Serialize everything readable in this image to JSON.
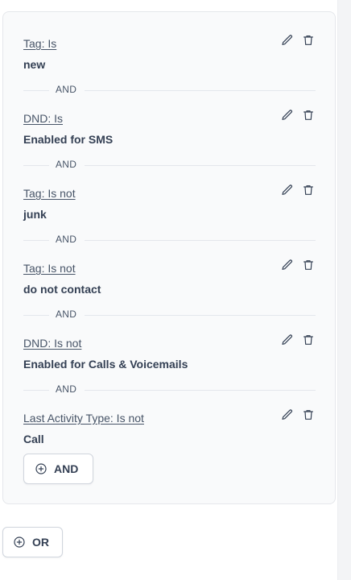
{
  "conditions": [
    {
      "label": "Tag:  Is",
      "value": "new"
    },
    {
      "label": "DND:  Is",
      "value": "Enabled for SMS"
    },
    {
      "label": "Tag:  Is not",
      "value": "junk"
    },
    {
      "label": "Tag:  Is not",
      "value": "do not contact"
    },
    {
      "label": "DND:  Is not",
      "value": "Enabled for Calls & Voicemails"
    },
    {
      "label": "Last Activity Type:  Is not",
      "value": "Call"
    }
  ],
  "separator_label": "AND",
  "add_and_label": "AND",
  "add_or_label": "OR"
}
